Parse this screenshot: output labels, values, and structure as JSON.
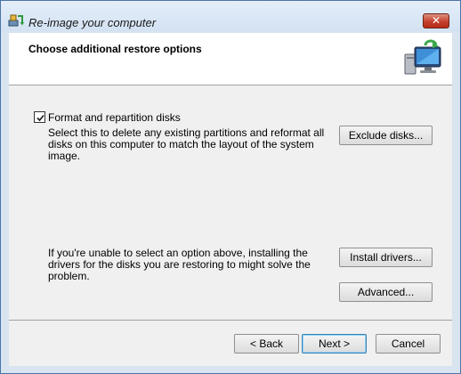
{
  "window": {
    "title": "Re-image your computer",
    "close_label": "✕"
  },
  "header": {
    "title": "Choose additional restore options"
  },
  "format_option": {
    "checked": true,
    "label": "Format and repartition disks",
    "description": "Select this to delete any existing partitions and reformat all disks on this computer to match the layout of the system image.",
    "button_label": "Exclude disks..."
  },
  "drivers_option": {
    "description": "If you're unable to select an option above, installing the drivers for the disks you are restoring to might solve the problem.",
    "install_label": "Install drivers...",
    "advanced_label": "Advanced..."
  },
  "footer": {
    "back_label": "< Back",
    "next_label": "Next >",
    "cancel_label": "Cancel"
  },
  "colors": {
    "accent": "#3c7fb1",
    "close": "#c5412f",
    "frame": "#d8e4f0"
  },
  "icons": {
    "title": "backup-restore-icon",
    "header": "computer-restore-icon"
  }
}
